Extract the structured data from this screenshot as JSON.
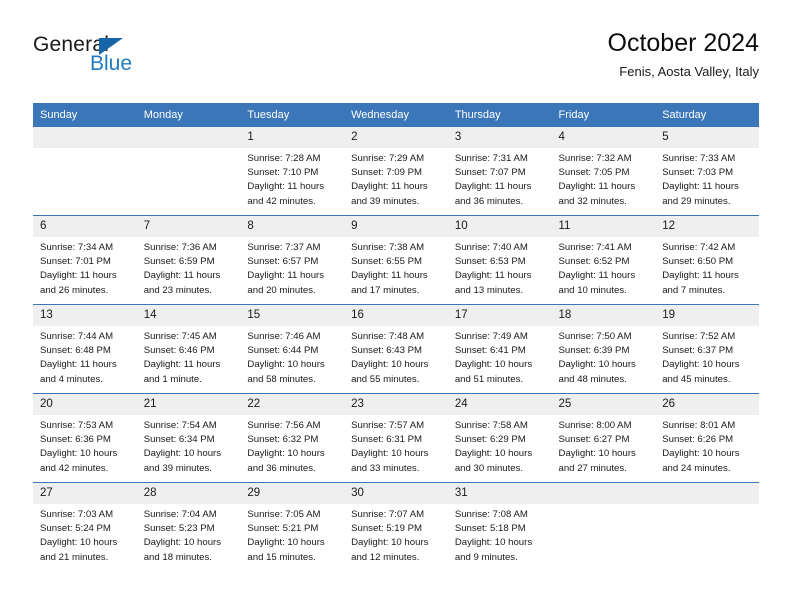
{
  "brand": {
    "name_top": "General",
    "name_bottom": "Blue",
    "accent_color": "#1f7bc1",
    "triangle_color": "#1565a8"
  },
  "header": {
    "title": "October 2024",
    "subtitle": "Fenis, Aosta Valley, Italy"
  },
  "calendar": {
    "header_bg": "#3a76b8",
    "daynum_bg": "#efefef",
    "weekdays": [
      "Sunday",
      "Monday",
      "Tuesday",
      "Wednesday",
      "Thursday",
      "Friday",
      "Saturday"
    ],
    "weeks": [
      [
        {
          "day": "",
          "blank": true,
          "sunrise": "",
          "sunset": "",
          "daylight_1": "",
          "daylight_2": ""
        },
        {
          "day": "",
          "blank": true,
          "sunrise": "",
          "sunset": "",
          "daylight_1": "",
          "daylight_2": ""
        },
        {
          "day": "1",
          "sunrise": "Sunrise: 7:28 AM",
          "sunset": "Sunset: 7:10 PM",
          "daylight_1": "Daylight: 11 hours",
          "daylight_2": "and 42 minutes."
        },
        {
          "day": "2",
          "sunrise": "Sunrise: 7:29 AM",
          "sunset": "Sunset: 7:09 PM",
          "daylight_1": "Daylight: 11 hours",
          "daylight_2": "and 39 minutes."
        },
        {
          "day": "3",
          "sunrise": "Sunrise: 7:31 AM",
          "sunset": "Sunset: 7:07 PM",
          "daylight_1": "Daylight: 11 hours",
          "daylight_2": "and 36 minutes."
        },
        {
          "day": "4",
          "sunrise": "Sunrise: 7:32 AM",
          "sunset": "Sunset: 7:05 PM",
          "daylight_1": "Daylight: 11 hours",
          "daylight_2": "and 32 minutes."
        },
        {
          "day": "5",
          "sunrise": "Sunrise: 7:33 AM",
          "sunset": "Sunset: 7:03 PM",
          "daylight_1": "Daylight: 11 hours",
          "daylight_2": "and 29 minutes."
        }
      ],
      [
        {
          "day": "6",
          "sunrise": "Sunrise: 7:34 AM",
          "sunset": "Sunset: 7:01 PM",
          "daylight_1": "Daylight: 11 hours",
          "daylight_2": "and 26 minutes."
        },
        {
          "day": "7",
          "sunrise": "Sunrise: 7:36 AM",
          "sunset": "Sunset: 6:59 PM",
          "daylight_1": "Daylight: 11 hours",
          "daylight_2": "and 23 minutes."
        },
        {
          "day": "8",
          "sunrise": "Sunrise: 7:37 AM",
          "sunset": "Sunset: 6:57 PM",
          "daylight_1": "Daylight: 11 hours",
          "daylight_2": "and 20 minutes."
        },
        {
          "day": "9",
          "sunrise": "Sunrise: 7:38 AM",
          "sunset": "Sunset: 6:55 PM",
          "daylight_1": "Daylight: 11 hours",
          "daylight_2": "and 17 minutes."
        },
        {
          "day": "10",
          "sunrise": "Sunrise: 7:40 AM",
          "sunset": "Sunset: 6:53 PM",
          "daylight_1": "Daylight: 11 hours",
          "daylight_2": "and 13 minutes."
        },
        {
          "day": "11",
          "sunrise": "Sunrise: 7:41 AM",
          "sunset": "Sunset: 6:52 PM",
          "daylight_1": "Daylight: 11 hours",
          "daylight_2": "and 10 minutes."
        },
        {
          "day": "12",
          "sunrise": "Sunrise: 7:42 AM",
          "sunset": "Sunset: 6:50 PM",
          "daylight_1": "Daylight: 11 hours",
          "daylight_2": "and 7 minutes."
        }
      ],
      [
        {
          "day": "13",
          "sunrise": "Sunrise: 7:44 AM",
          "sunset": "Sunset: 6:48 PM",
          "daylight_1": "Daylight: 11 hours",
          "daylight_2": "and 4 minutes."
        },
        {
          "day": "14",
          "sunrise": "Sunrise: 7:45 AM",
          "sunset": "Sunset: 6:46 PM",
          "daylight_1": "Daylight: 11 hours",
          "daylight_2": "and 1 minute."
        },
        {
          "day": "15",
          "sunrise": "Sunrise: 7:46 AM",
          "sunset": "Sunset: 6:44 PM",
          "daylight_1": "Daylight: 10 hours",
          "daylight_2": "and 58 minutes."
        },
        {
          "day": "16",
          "sunrise": "Sunrise: 7:48 AM",
          "sunset": "Sunset: 6:43 PM",
          "daylight_1": "Daylight: 10 hours",
          "daylight_2": "and 55 minutes."
        },
        {
          "day": "17",
          "sunrise": "Sunrise: 7:49 AM",
          "sunset": "Sunset: 6:41 PM",
          "daylight_1": "Daylight: 10 hours",
          "daylight_2": "and 51 minutes."
        },
        {
          "day": "18",
          "sunrise": "Sunrise: 7:50 AM",
          "sunset": "Sunset: 6:39 PM",
          "daylight_1": "Daylight: 10 hours",
          "daylight_2": "and 48 minutes."
        },
        {
          "day": "19",
          "sunrise": "Sunrise: 7:52 AM",
          "sunset": "Sunset: 6:37 PM",
          "daylight_1": "Daylight: 10 hours",
          "daylight_2": "and 45 minutes."
        }
      ],
      [
        {
          "day": "20",
          "sunrise": "Sunrise: 7:53 AM",
          "sunset": "Sunset: 6:36 PM",
          "daylight_1": "Daylight: 10 hours",
          "daylight_2": "and 42 minutes."
        },
        {
          "day": "21",
          "sunrise": "Sunrise: 7:54 AM",
          "sunset": "Sunset: 6:34 PM",
          "daylight_1": "Daylight: 10 hours",
          "daylight_2": "and 39 minutes."
        },
        {
          "day": "22",
          "sunrise": "Sunrise: 7:56 AM",
          "sunset": "Sunset: 6:32 PM",
          "daylight_1": "Daylight: 10 hours",
          "daylight_2": "and 36 minutes."
        },
        {
          "day": "23",
          "sunrise": "Sunrise: 7:57 AM",
          "sunset": "Sunset: 6:31 PM",
          "daylight_1": "Daylight: 10 hours",
          "daylight_2": "and 33 minutes."
        },
        {
          "day": "24",
          "sunrise": "Sunrise: 7:58 AM",
          "sunset": "Sunset: 6:29 PM",
          "daylight_1": "Daylight: 10 hours",
          "daylight_2": "and 30 minutes."
        },
        {
          "day": "25",
          "sunrise": "Sunrise: 8:00 AM",
          "sunset": "Sunset: 6:27 PM",
          "daylight_1": "Daylight: 10 hours",
          "daylight_2": "and 27 minutes."
        },
        {
          "day": "26",
          "sunrise": "Sunrise: 8:01 AM",
          "sunset": "Sunset: 6:26 PM",
          "daylight_1": "Daylight: 10 hours",
          "daylight_2": "and 24 minutes."
        }
      ],
      [
        {
          "day": "27",
          "sunrise": "Sunrise: 7:03 AM",
          "sunset": "Sunset: 5:24 PM",
          "daylight_1": "Daylight: 10 hours",
          "daylight_2": "and 21 minutes."
        },
        {
          "day": "28",
          "sunrise": "Sunrise: 7:04 AM",
          "sunset": "Sunset: 5:23 PM",
          "daylight_1": "Daylight: 10 hours",
          "daylight_2": "and 18 minutes."
        },
        {
          "day": "29",
          "sunrise": "Sunrise: 7:05 AM",
          "sunset": "Sunset: 5:21 PM",
          "daylight_1": "Daylight: 10 hours",
          "daylight_2": "and 15 minutes."
        },
        {
          "day": "30",
          "sunrise": "Sunrise: 7:07 AM",
          "sunset": "Sunset: 5:19 PM",
          "daylight_1": "Daylight: 10 hours",
          "daylight_2": "and 12 minutes."
        },
        {
          "day": "31",
          "sunrise": "Sunrise: 7:08 AM",
          "sunset": "Sunset: 5:18 PM",
          "daylight_1": "Daylight: 10 hours",
          "daylight_2": "and 9 minutes."
        },
        {
          "day": "",
          "blank": true,
          "sunrise": "",
          "sunset": "",
          "daylight_1": "",
          "daylight_2": ""
        },
        {
          "day": "",
          "blank": true,
          "sunrise": "",
          "sunset": "",
          "daylight_1": "",
          "daylight_2": ""
        }
      ]
    ]
  }
}
